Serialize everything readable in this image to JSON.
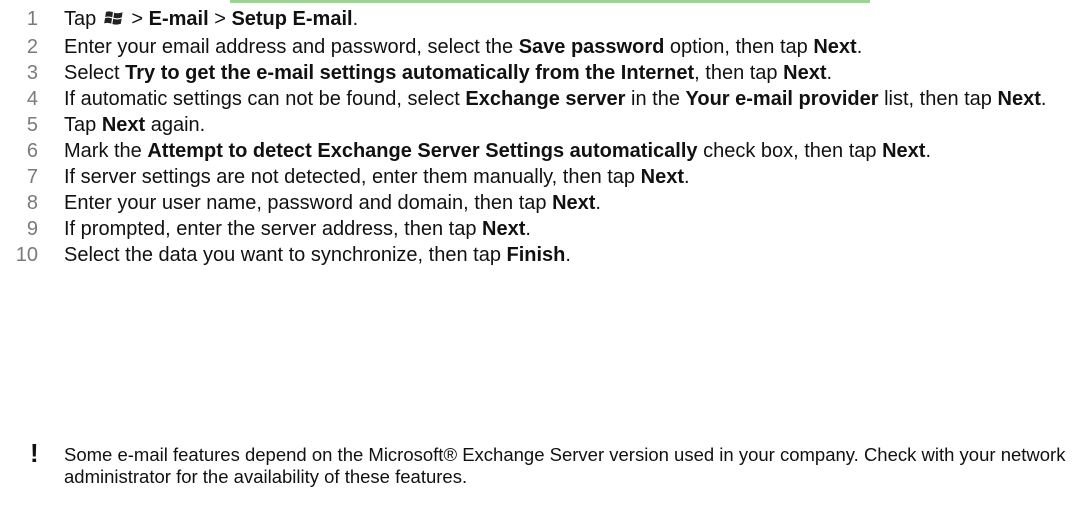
{
  "steps": [
    {
      "num": "1",
      "parts": [
        {
          "t": "Tap "
        },
        {
          "icon": "windows-start-icon"
        },
        {
          "t": " > "
        },
        {
          "b": "E-mail"
        },
        {
          "t": " > "
        },
        {
          "b": "Setup E-mail"
        },
        {
          "t": "."
        }
      ]
    },
    {
      "num": "2",
      "parts": [
        {
          "t": "Enter your email address and password, select the "
        },
        {
          "b": "Save password"
        },
        {
          "t": " option, then tap "
        },
        {
          "b": "Next"
        },
        {
          "t": "."
        }
      ]
    },
    {
      "num": "3",
      "parts": [
        {
          "t": "Select "
        },
        {
          "b": "Try to get the e-mail settings automatically from the Internet"
        },
        {
          "t": ", then tap "
        },
        {
          "b": "Next"
        },
        {
          "t": "."
        }
      ]
    },
    {
      "num": "4",
      "parts": [
        {
          "t": "If automatic settings can not be found, select "
        },
        {
          "b": "Exchange server"
        },
        {
          "t": " in the "
        },
        {
          "b": "Your e-mail provider"
        },
        {
          "t": " list, then tap "
        },
        {
          "b": "Next"
        },
        {
          "t": "."
        }
      ]
    },
    {
      "num": "5",
      "parts": [
        {
          "t": "Tap "
        },
        {
          "b": "Next"
        },
        {
          "t": " again."
        }
      ]
    },
    {
      "num": "6",
      "parts": [
        {
          "t": "Mark the "
        },
        {
          "b": "Attempt to detect Exchange Server Settings automatically"
        },
        {
          "t": " check box, then tap "
        },
        {
          "b": "Next"
        },
        {
          "t": "."
        }
      ]
    },
    {
      "num": "7",
      "parts": [
        {
          "t": "If server settings are not detected, enter them manually, then tap "
        },
        {
          "b": "Next"
        },
        {
          "t": "."
        }
      ]
    },
    {
      "num": "8",
      "parts": [
        {
          "t": "Enter your user name, password and domain, then tap "
        },
        {
          "b": "Next"
        },
        {
          "t": "."
        }
      ]
    },
    {
      "num": "9",
      "parts": [
        {
          "t": "If prompted, enter the server address, then tap "
        },
        {
          "b": "Next"
        },
        {
          "t": "."
        }
      ]
    },
    {
      "num": "10",
      "parts": [
        {
          "t": "Select the data you want to synchronize, then tap "
        },
        {
          "b": "Finish"
        },
        {
          "t": "."
        }
      ]
    }
  ],
  "note": {
    "icon": "exclamation-icon",
    "symbol": "!",
    "text": "Some e-mail features depend on the Microsoft® Exchange Server version used in your company. Check with your network administrator for the availability of these features."
  }
}
